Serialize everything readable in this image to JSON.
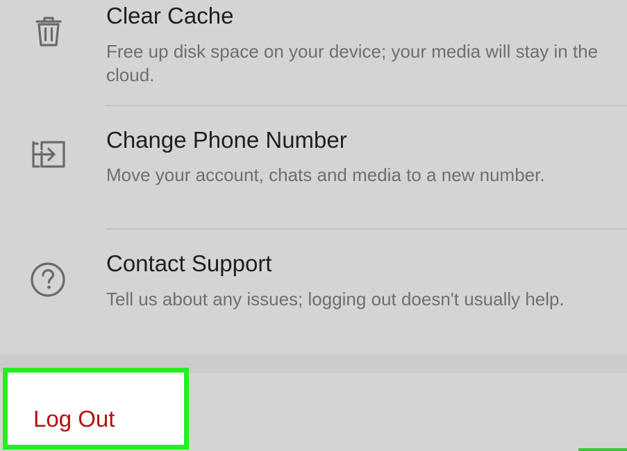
{
  "settings": {
    "items": [
      {
        "icon": "trash-icon",
        "title": "Clear Cache",
        "description": "Free up disk space on your device; your media will stay in the cloud."
      },
      {
        "icon": "transfer-icon",
        "title": "Change Phone Number",
        "description": "Move your account, chats and media to a new number."
      },
      {
        "icon": "help-icon",
        "title": "Contact Support",
        "description": "Tell us about any issues; logging out doesn't usually help."
      }
    ],
    "logout": {
      "label": "Log Out",
      "color": "#b00f0f",
      "highlight_color": "#22f022"
    }
  }
}
